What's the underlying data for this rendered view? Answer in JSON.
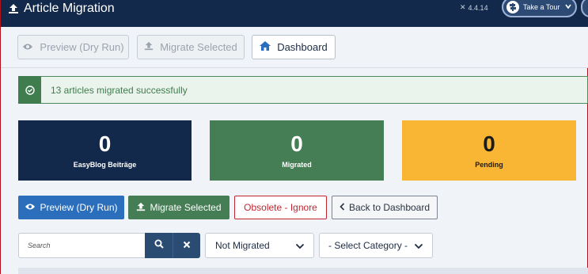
{
  "header": {
    "title": "Article Migration",
    "version": "4.4.14",
    "tour_label": "Take a Tour"
  },
  "toolbar": {
    "preview_label": "Preview (Dry Run)",
    "migrate_label": "Migrate Selected",
    "dashboard_label": "Dashboard"
  },
  "alert": {
    "message": "13 articles migrated successfully"
  },
  "stats": [
    {
      "value": "0",
      "label": "EasyBlog Beiträge",
      "color": "#13294b"
    },
    {
      "value": "0",
      "label": "Migrated",
      "color": "#457d54"
    },
    {
      "value": "0",
      "label": "Pending",
      "color": "#f8b634"
    }
  ],
  "actions": {
    "preview_label": "Preview (Dry Run)",
    "migrate_label": "Migrate Selected",
    "obsolete_label": "Obsolete - Ignore",
    "back_label": "Back to Dashboard"
  },
  "filters": {
    "search_placeholder": "Search",
    "status_selected": "Not Migrated",
    "category_selected": "- Select Category -"
  }
}
